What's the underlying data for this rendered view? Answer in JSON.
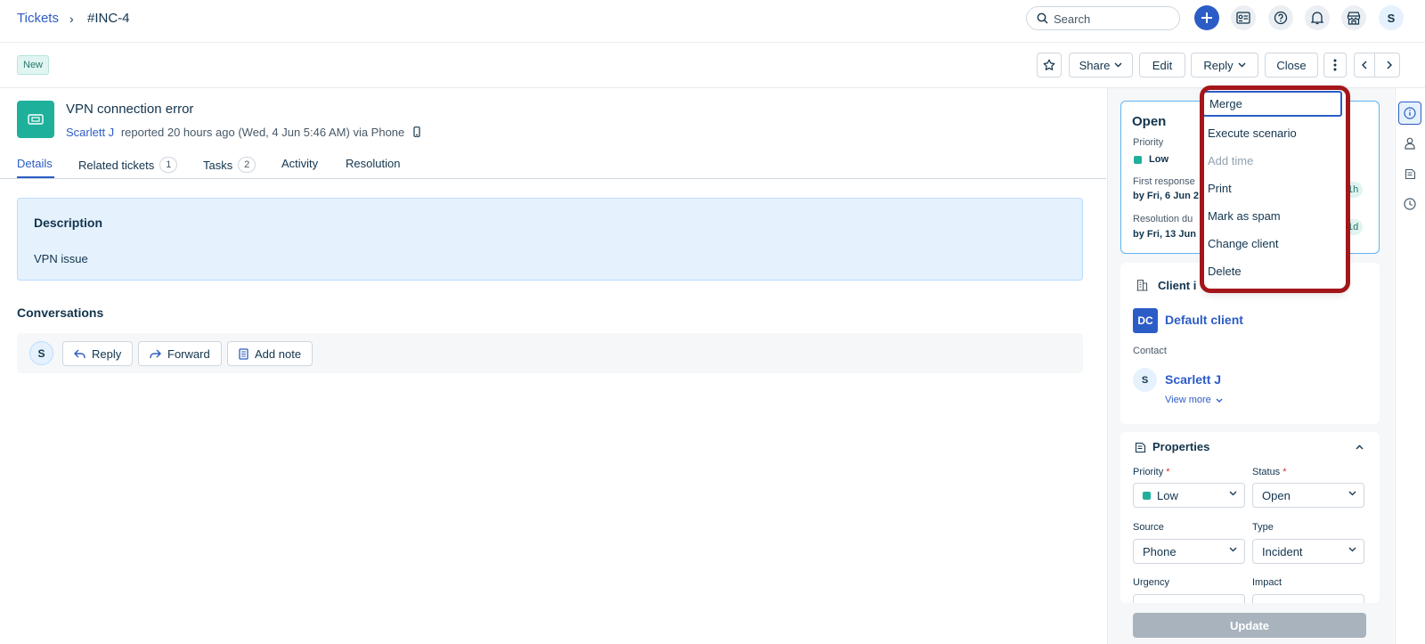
{
  "header": {
    "breadcrumb_root": "Tickets",
    "breadcrumb_sep": "›",
    "ticket_id": "#INC-4",
    "search_placeholder": "Search",
    "avatar_initial": "S"
  },
  "toolbar": {
    "status_badge": "New",
    "share_label": "Share",
    "edit_label": "Edit",
    "reply_label": "Reply",
    "close_label": "Close"
  },
  "ticket": {
    "title": "VPN connection error",
    "reporter": "Scarlett J",
    "meta": "reported 20 hours ago (Wed, 4 Jun 5:46 AM) via Phone"
  },
  "tabs": [
    {
      "label": "Details"
    },
    {
      "label": "Related tickets",
      "count": "1"
    },
    {
      "label": "Tasks",
      "count": "2"
    },
    {
      "label": "Activity"
    },
    {
      "label": "Resolution"
    }
  ],
  "description": {
    "heading": "Description",
    "body": "VPN issue"
  },
  "conversations": {
    "heading": "Conversations",
    "avatar_initial": "S",
    "reply_label": "Reply",
    "forward_label": "Forward",
    "add_note_label": "Add note"
  },
  "status_card": {
    "title": "Open",
    "priority_label": "Priority",
    "priority_value": "Low",
    "first_response_label": "First response",
    "first_response_value": "by Fri, 6 Jun 2",
    "first_response_pill": "1h",
    "resolution_label": "Resolution du",
    "resolution_value": "by Fri, 13 Jun",
    "resolution_pill": "1d"
  },
  "client_card": {
    "title": "Client i",
    "client_initials": "DC",
    "client_name": "Default client",
    "contact_label": "Contact",
    "contact_initial": "S",
    "contact_name": "Scarlett J",
    "view_more": "View more"
  },
  "properties": {
    "title": "Properties",
    "priority_label": "Priority",
    "priority_value": "Low",
    "status_label": "Status",
    "status_value": "Open",
    "source_label": "Source",
    "source_value": "Phone",
    "type_label": "Type",
    "type_value": "Incident",
    "urgency_label": "Urgency",
    "impact_label": "Impact",
    "required_mark": "*",
    "update_label": "Update"
  },
  "more_menu": {
    "items": [
      {
        "label": "Merge"
      },
      {
        "label": "Execute scenario"
      },
      {
        "label": "Add time"
      },
      {
        "label": "Print"
      },
      {
        "label": "Mark as spam"
      },
      {
        "label": "Change client"
      },
      {
        "label": "Delete"
      }
    ]
  },
  "colors": {
    "accent": "#2c5cc5",
    "highlight": "#a4161a",
    "success": "#1eb09b"
  }
}
